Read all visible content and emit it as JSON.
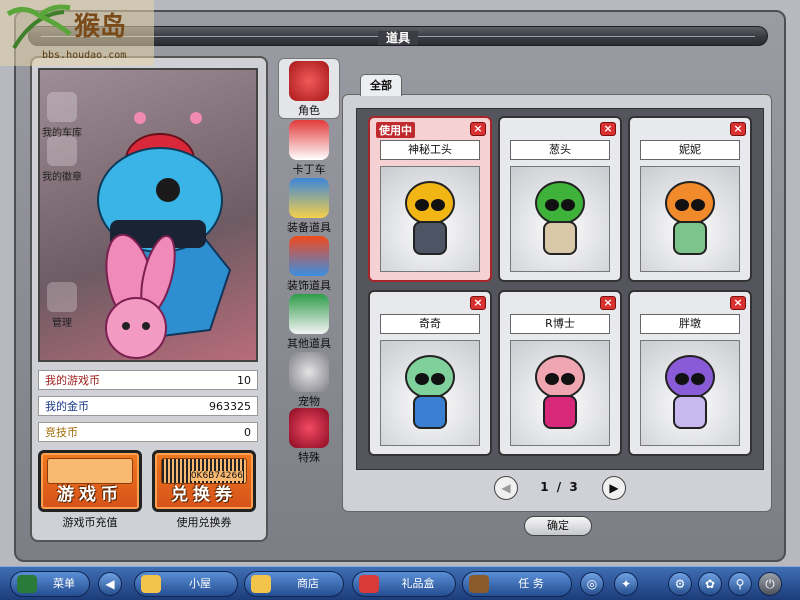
{
  "window": {
    "title": "道具"
  },
  "watermark": {
    "text": "猴岛",
    "url": "bbs.houdao.com"
  },
  "left_nav": [
    {
      "label": "我的车库",
      "icon": "garage-icon"
    },
    {
      "label": "我的徽章",
      "icon": "medal-icon"
    },
    {
      "label": "管理",
      "icon": "tools-icon"
    }
  ],
  "stats": [
    {
      "label": "我的游戏币",
      "value": "10"
    },
    {
      "label": "我的金币",
      "value": "963325"
    },
    {
      "label": "竞技币",
      "value": "0"
    }
  ],
  "buttons": {
    "coin": {
      "face": "游戏币",
      "caption": "游戏币充值"
    },
    "coupon": {
      "face": "兑换券",
      "caption": "使用兑换券",
      "barcode": "0K6B74266"
    }
  },
  "categories": [
    {
      "label": "角色",
      "icon": "character-icon",
      "active": true
    },
    {
      "label": "卡丁车",
      "icon": "kart-icon"
    },
    {
      "label": "装备道具",
      "icon": "goggles-icon"
    },
    {
      "label": "装饰道具",
      "icon": "flame-icon"
    },
    {
      "label": "其他道具",
      "icon": "card-icon"
    },
    {
      "label": "宠物",
      "icon": "cat-icon"
    },
    {
      "label": "特殊",
      "icon": "gem-icon"
    }
  ],
  "tab": {
    "label": "全部"
  },
  "in_use_label": "使用中",
  "items": [
    {
      "name": "神秘工头",
      "in_use": true,
      "head": "#f2b614",
      "body": "#4d5565"
    },
    {
      "name": "葱头",
      "in_use": false,
      "head": "#3fb23a",
      "body": "#d8c8a8"
    },
    {
      "name": "妮妮",
      "in_use": false,
      "head": "#f08a2a",
      "body": "#7dc48a"
    },
    {
      "name": "奇奇",
      "in_use": false,
      "head": "#7fd09a",
      "body": "#3a7fd2"
    },
    {
      "name": "R博士",
      "in_use": false,
      "head": "#f0a6b0",
      "body": "#d8287a"
    },
    {
      "name": "胖墩",
      "in_use": false,
      "head": "#8a5bd6",
      "body": "#c9b8ef"
    }
  ],
  "pager": {
    "text": "1 / 3"
  },
  "ok_label": "确定",
  "taskbar": {
    "menu": "菜单",
    "house": "小屋",
    "shop": "商店",
    "giftbox": "礼品盒",
    "tasks": "任 务"
  }
}
